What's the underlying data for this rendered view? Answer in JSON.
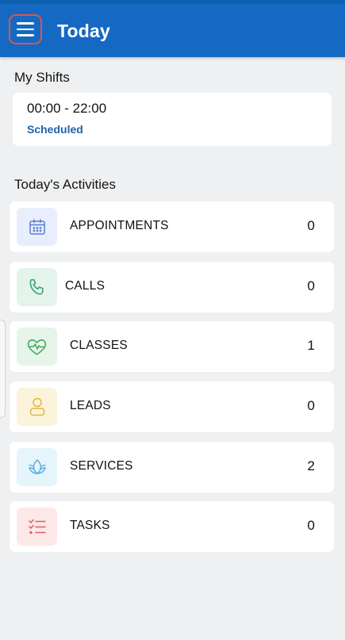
{
  "header": {
    "title": "Today"
  },
  "shifts": {
    "title": "My Shifts",
    "time": "00:00 - 22:00",
    "status": "Scheduled"
  },
  "activities": {
    "title": "Today's Activities",
    "items": [
      {
        "label": "APPOINTMENTS",
        "count": "0",
        "icon": "calendar-icon",
        "icon_color": "#5a7fd6",
        "icon_bg": "#e8eefb"
      },
      {
        "label": "CALLS",
        "count": "0",
        "icon": "phone-icon",
        "icon_color": "#3aa67a",
        "icon_bg": "#e4f4ed"
      },
      {
        "label": "CLASSES",
        "count": "1",
        "icon": "heart-pulse-icon",
        "icon_color": "#43a860",
        "icon_bg": "#e6f4ea"
      },
      {
        "label": "LEADS",
        "count": "0",
        "icon": "person-icon",
        "icon_color": "#e3b634",
        "icon_bg": "#fcf3dc"
      },
      {
        "label": "SERVICES",
        "count": "2",
        "icon": "lotus-icon",
        "icon_color": "#52aedf",
        "icon_bg": "#e6f4fb"
      },
      {
        "label": "TASKS",
        "count": "0",
        "icon": "checklist-icon",
        "icon_color": "#e35b5b",
        "icon_bg": "#fde8e8"
      }
    ]
  }
}
